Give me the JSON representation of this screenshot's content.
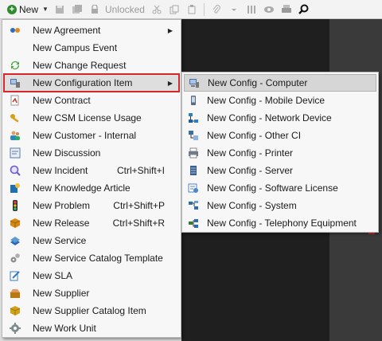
{
  "toolbar": {
    "new_label": "New",
    "unlocked_label": "Unlocked",
    "icons": [
      "new-plus-icon",
      "dropdown-caret-icon",
      "save-icon",
      "save-all-icon",
      "lock-icon",
      "cut-icon",
      "copy-icon",
      "paste-icon",
      "attach-icon",
      "columns-icon",
      "view-icon",
      "print-icon",
      "search-icon"
    ]
  },
  "menu": {
    "items": [
      {
        "label": "New Agreement",
        "shortcut": "",
        "submenu": true,
        "icon": "agreement-icon",
        "color": "#2b6cc4"
      },
      {
        "label": "New Campus Event",
        "shortcut": "",
        "submenu": false,
        "icon": "campus-event-icon",
        "color": "#cccccc"
      },
      {
        "label": "New Change Request",
        "shortcut": "",
        "submenu": false,
        "icon": "change-request-icon",
        "color": "#3aa035"
      },
      {
        "label": "New Configuration Item",
        "shortcut": "",
        "submenu": true,
        "icon": "configuration-item-icon",
        "color": "#4a6fa5"
      },
      {
        "label": "New Contract",
        "shortcut": "",
        "submenu": false,
        "icon": "contract-icon",
        "color": "#c0392b"
      },
      {
        "label": "New CSM License Usage",
        "shortcut": "",
        "submenu": false,
        "icon": "license-usage-icon",
        "color": "#d4a017"
      },
      {
        "label": "New Customer - Internal",
        "shortcut": "",
        "submenu": false,
        "icon": "customer-icon",
        "color": "#2e86c1"
      },
      {
        "label": "New Discussion",
        "shortcut": "",
        "submenu": false,
        "icon": "discussion-icon",
        "color": "#5a7ca8"
      },
      {
        "label": "New Incident",
        "shortcut": "Ctrl+Shift+I",
        "submenu": false,
        "icon": "incident-icon",
        "color": "#6a5acd"
      },
      {
        "label": "New Knowledge Article",
        "shortcut": "",
        "submenu": false,
        "icon": "knowledge-article-icon",
        "color": "#1f6fb5"
      },
      {
        "label": "New Problem",
        "shortcut": "Ctrl+Shift+P",
        "submenu": false,
        "icon": "problem-icon",
        "color": "#c8a000"
      },
      {
        "label": "New Release",
        "shortcut": "Ctrl+Shift+R",
        "submenu": false,
        "icon": "release-icon",
        "color": "#d68910"
      },
      {
        "label": "New Service",
        "shortcut": "",
        "submenu": false,
        "icon": "service-icon",
        "color": "#2a66b8"
      },
      {
        "label": "New Service Catalog Template",
        "shortcut": "",
        "submenu": false,
        "icon": "catalog-template-icon",
        "color": "#8e8e8e"
      },
      {
        "label": "New SLA",
        "shortcut": "",
        "submenu": false,
        "icon": "sla-icon",
        "color": "#3b78c4"
      },
      {
        "label": "New Supplier",
        "shortcut": "",
        "submenu": false,
        "icon": "supplier-icon",
        "color": "#b9770e"
      },
      {
        "label": "New Supplier Catalog Item",
        "shortcut": "",
        "submenu": false,
        "icon": "supplier-catalog-icon",
        "color": "#d4a017"
      },
      {
        "label": "New Work Unit",
        "shortcut": "",
        "submenu": false,
        "icon": "work-unit-icon",
        "color": "#7f8c8d"
      }
    ]
  },
  "submenu": {
    "items": [
      {
        "label": "New Config - Computer",
        "icon": "computer-icon",
        "color": "#4a6fa5"
      },
      {
        "label": "New Config - Mobile Device",
        "icon": "mobile-device-icon",
        "color": "#5a6b7c"
      },
      {
        "label": "New Config - Network Device",
        "icon": "network-device-icon",
        "color": "#2f7fc1"
      },
      {
        "label": "New Config - Other CI",
        "icon": "other-ci-icon",
        "color": "#3b6ea5"
      },
      {
        "label": "New Config - Printer",
        "icon": "printer-icon",
        "color": "#6b7b8c"
      },
      {
        "label": "New Config - Server",
        "icon": "server-icon",
        "color": "#3a5f8a"
      },
      {
        "label": "New Config - Software License",
        "icon": "software-license-icon",
        "color": "#4f86c6"
      },
      {
        "label": "New Config - System",
        "icon": "system-icon",
        "color": "#2c6db0"
      },
      {
        "label": "New Config - Telephony Equipment",
        "icon": "telephony-icon",
        "color": "#2e7d32"
      }
    ]
  }
}
